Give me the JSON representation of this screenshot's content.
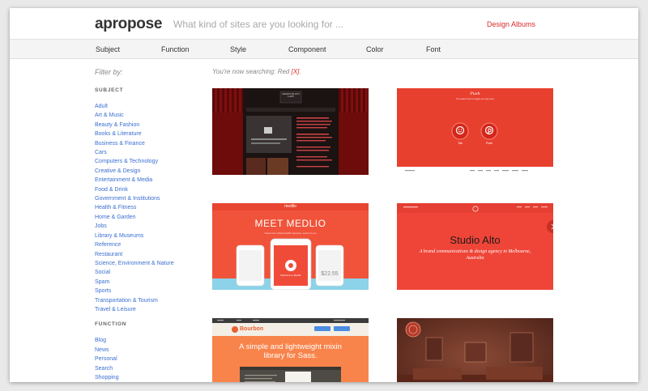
{
  "header": {
    "logo": "apropose",
    "search_placeholder": "What kind of sites are you looking for ...",
    "albums_link": "Design Albums"
  },
  "nav": [
    "Subject",
    "Function",
    "Style",
    "Component",
    "Color",
    "Font"
  ],
  "sidebar": {
    "filter_label": "Filter by:",
    "subject_heading": "SUBJECT",
    "subjects": [
      "Adult",
      "Art & Music",
      "Beauty & Fashion",
      "Books & Literature",
      "Business & Finance",
      "Cars",
      "Computers & Technology",
      "Creative & Design",
      "Entertainment & Media",
      "Food & Drink",
      "Government & Institutions",
      "Health & Fitness",
      "Home & Garden",
      "Jobs",
      "Library & Museums",
      "Reference",
      "Restaurant",
      "Science, Environment & Nature",
      "Social",
      "Spam",
      "Sports",
      "Transportation & Tourism",
      "Travel & Leisure"
    ],
    "function_heading": "FUNCTION",
    "functions": [
      "Blog",
      "News",
      "Personal",
      "Search",
      "Shopping"
    ]
  },
  "status": {
    "text": "You're now searching: Red",
    "clear": "[X]",
    "end": "."
  },
  "thumbs": {
    "t1": {
      "logo": "MOODY BLUES CAFE"
    },
    "t2": {
      "brand": "Push",
      "tagline": "The easiest way to engage your app users",
      "left_label": "Tab",
      "right_label": "Push"
    },
    "t3": {
      "brand": "medlio",
      "headline": "MEET MEDLIO",
      "sub": "Great one's Critical Health Insurance, send it to you",
      "phone_text": "Welcome to Medlio",
      "price": "$22.55"
    },
    "t4": {
      "title": "Studio Alto",
      "subtitle": "A brand communications & design agency in Melbourne, Australia"
    },
    "t5": {
      "brand": "Bourbon",
      "headline": "A simple and lightweight mixin library for Sass."
    }
  },
  "colors": {
    "accent": "#d92a2a",
    "link": "#3a6fd1"
  }
}
